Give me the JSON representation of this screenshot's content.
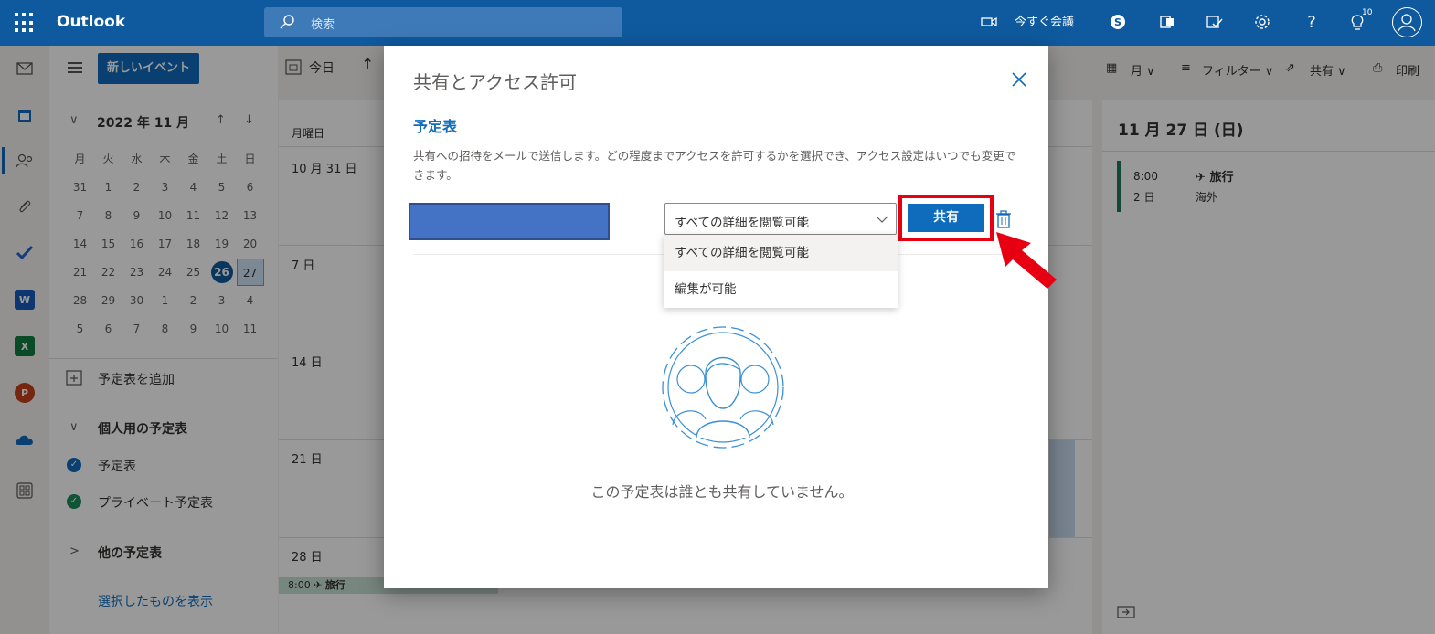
{
  "app": {
    "brand": "Outlook",
    "search_placeholder": "検索",
    "meet_now": "今すぐ会議",
    "badge_count": "10"
  },
  "left": {
    "new_event": "新しいイベント",
    "month_header": "2022 年 11 月",
    "weekdays": [
      "月",
      "火",
      "水",
      "木",
      "金",
      "土",
      "日"
    ],
    "weeks": [
      [
        "31",
        "1",
        "2",
        "3",
        "4",
        "5",
        "6"
      ],
      [
        "7",
        "8",
        "9",
        "10",
        "11",
        "12",
        "13"
      ],
      [
        "14",
        "15",
        "16",
        "17",
        "18",
        "19",
        "20"
      ],
      [
        "21",
        "22",
        "23",
        "24",
        "25",
        "26",
        "27"
      ],
      [
        "28",
        "29",
        "30",
        "1",
        "2",
        "3",
        "4"
      ],
      [
        "5",
        "6",
        "7",
        "8",
        "9",
        "10",
        "11"
      ]
    ],
    "add_calendar": "予定表を追加",
    "personal_group": "個人用の予定表",
    "cal_1": "予定表",
    "cal_2": "プライベート予定表",
    "other_group": "他の予定表",
    "show_selected": "選択したものを表示",
    "cal_1_color": "#0f6cbd",
    "cal_2_color": "#1b8a5a"
  },
  "grid": {
    "today": "今日",
    "weekday_header": "月曜日",
    "days": [
      "10 月 31 日",
      "7 日",
      "14 日",
      "21 日",
      "28 日"
    ],
    "event_time": "8:00",
    "event_title": "旅行"
  },
  "toolbar_right": {
    "view": "月",
    "filter": "フィルター",
    "share": "共有",
    "print": "印刷"
  },
  "right": {
    "date_title": "11 月 27 日 (日)",
    "event_time": "8:00",
    "event_duration": "2 日",
    "event_title": "旅行",
    "event_location": "海外",
    "event_color": "#1b7a5a"
  },
  "dialog": {
    "title": "共有とアクセス許可",
    "subtitle": "予定表",
    "description": "共有への招待をメールで送信します。どの程度までアクセスを許可するかを選択でき、アクセス設定はいつでも変更できます。",
    "permission_value": "すべての詳細を閲覧可能",
    "share_button": "共有",
    "options": [
      "すべての詳細を閲覧可能",
      "編集が可能"
    ],
    "empty_message": "この予定表は誰とも共有していません。",
    "highlight_color": "#e60012"
  }
}
